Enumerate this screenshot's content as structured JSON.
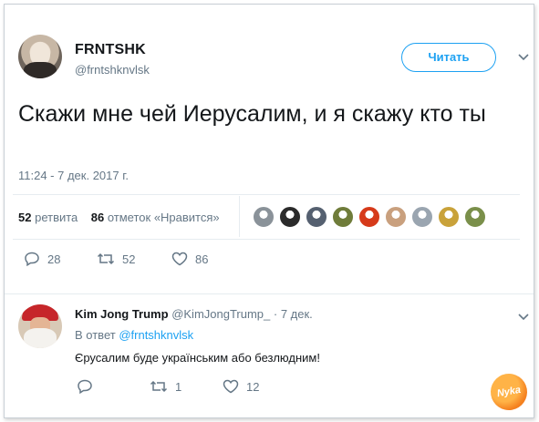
{
  "tweet": {
    "author_name": "FRNTSHK",
    "author_handle": "@frntshknvlsk",
    "follow_label": "Читать",
    "text": "Скажи мне чей Иерусалим, и я скажу кто ты",
    "timestamp": "11:24 - 7 дек. 2017 г.",
    "retweets_count": "52",
    "retweets_label": "ретвита",
    "likes_count": "86",
    "likes_label": "отметок «Нравится»",
    "action_reply_count": "28",
    "action_retweet_count": "52",
    "action_like_count": "86",
    "liker_avatar_colors": [
      "#8a9299",
      "#2b2b2b",
      "#556070",
      "#6f7c3a",
      "#d63a1a",
      "#c9a07e",
      "#9aa5b0",
      "#c9a23a",
      "#7a8f4a"
    ]
  },
  "reply": {
    "author_name": "Kim Jong Trump",
    "author_handle": "@KimJongTrump_ · 7 дек.",
    "in_reply_prefix": "В ответ",
    "in_reply_to": "@frntshknvlsk",
    "text": "Єрусалим буде українським або безлюдним!",
    "action_reply_count": "",
    "action_retweet_count": "1",
    "action_like_count": "12"
  },
  "watermark": "Nyka",
  "colors": {
    "accent": "#1da1f2",
    "muted": "#657786",
    "text": "#14171a",
    "divider": "#e6ecf0"
  }
}
